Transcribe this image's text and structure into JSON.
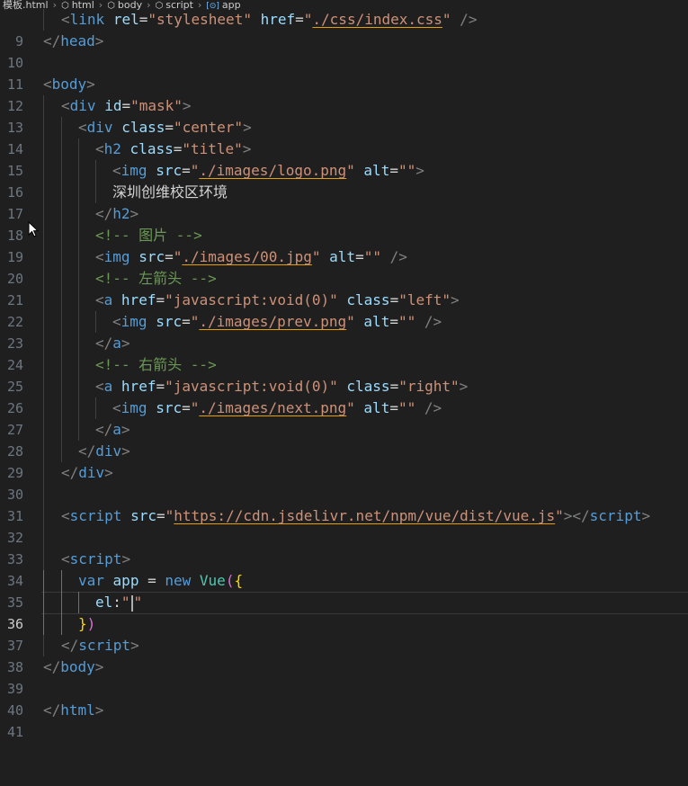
{
  "breadcrumb": {
    "items": [
      {
        "icon": "",
        "label": "模板.html"
      },
      {
        "icon": "cube-icon",
        "label": "html"
      },
      {
        "icon": "cube-icon",
        "label": "body"
      },
      {
        "icon": "cube-icon",
        "label": "script"
      },
      {
        "icon": "symbol-icon",
        "label": "app"
      }
    ]
  },
  "editor": {
    "current_line": "36",
    "colors": {
      "background": "#1f1f1f",
      "tag": "#569cd6",
      "attribute": "#9cdcfe",
      "string": "#ce9178",
      "comment": "#6a9955"
    },
    "lines": [
      {
        "num": "9",
        "parts": [
          "<",
          "link",
          " ",
          "rel",
          "=",
          "\"stylesheet\"",
          " ",
          "href",
          "=",
          "\"",
          "./css/index.css",
          "\"",
          " />"
        ]
      },
      {
        "num": "10",
        "parts": [
          "</",
          "head",
          ">"
        ]
      },
      {
        "num": "11",
        "parts": []
      },
      {
        "num": "12",
        "parts": [
          "<",
          "body",
          ">"
        ]
      },
      {
        "num": "13",
        "parts": [
          "<",
          "div",
          " ",
          "id",
          "=",
          "\"mask\"",
          ">"
        ]
      },
      {
        "num": "14",
        "parts": [
          "<",
          "div",
          " ",
          "class",
          "=",
          "\"center\"",
          ">"
        ]
      },
      {
        "num": "15",
        "parts": [
          "<",
          "h2",
          " ",
          "class",
          "=",
          "\"title\"",
          ">"
        ]
      },
      {
        "num": "16",
        "parts": [
          "<",
          "img",
          " ",
          "src",
          "=",
          "\"",
          "./images/logo.png",
          "\"",
          " ",
          "alt",
          "=",
          "\"\"",
          ">"
        ]
      },
      {
        "num": "17",
        "parts": [
          "深圳创维校区环境"
        ]
      },
      {
        "num": "18",
        "parts": [
          "</",
          "h2",
          ">"
        ]
      },
      {
        "num": "19",
        "parts": [
          "<!-- 图片 -->"
        ]
      },
      {
        "num": "20",
        "parts": [
          "<",
          "img",
          " ",
          "src",
          "=",
          "\"",
          "./images/00.jpg",
          "\"",
          " ",
          "alt",
          "=",
          "\"\"",
          " />"
        ]
      },
      {
        "num": "21",
        "parts": [
          "<!-- 左箭头 -->"
        ]
      },
      {
        "num": "22",
        "parts": [
          "<",
          "a",
          " ",
          "href",
          "=",
          "\"javascript:void(0)\"",
          " ",
          "class",
          "=",
          "\"left\"",
          ">"
        ]
      },
      {
        "num": "23",
        "parts": [
          "<",
          "img",
          " ",
          "src",
          "=",
          "\"",
          "./images/prev.png",
          "\"",
          " ",
          "alt",
          "=",
          "\"\"",
          " />"
        ]
      },
      {
        "num": "24",
        "parts": [
          "</",
          "a",
          ">"
        ]
      },
      {
        "num": "25",
        "parts": [
          "<!-- 右箭头 -->"
        ]
      },
      {
        "num": "26",
        "parts": [
          "<",
          "a",
          " ",
          "href",
          "=",
          "\"javascript:void(0)\"",
          " ",
          "class",
          "=",
          "\"right\"",
          ">"
        ]
      },
      {
        "num": "27",
        "parts": [
          "<",
          "img",
          " ",
          "src",
          "=",
          "\"",
          "./images/next.png",
          "\"",
          " ",
          "alt",
          "=",
          "\"\"",
          " />"
        ]
      },
      {
        "num": "28",
        "parts": [
          "</",
          "a",
          ">"
        ]
      },
      {
        "num": "29",
        "parts": [
          "</",
          "div",
          ">"
        ]
      },
      {
        "num": "30",
        "parts": [
          "</",
          "div",
          ">"
        ]
      },
      {
        "num": "31",
        "parts": []
      },
      {
        "num": "32",
        "parts": [
          "<",
          "script",
          " ",
          "src",
          "=",
          "\"",
          "https://cdn.jsdelivr.net/npm/vue/dist/vue.js",
          "\"",
          "></",
          "script",
          ">"
        ]
      },
      {
        "num": "33",
        "parts": []
      },
      {
        "num": "34",
        "parts": [
          "<",
          "script",
          ">"
        ]
      },
      {
        "num": "35",
        "parts": [
          "var",
          " ",
          "app",
          " = ",
          "new",
          " ",
          "Vue",
          "(",
          "{"
        ]
      },
      {
        "num": "36",
        "parts": [
          "el",
          ":",
          "\"",
          "\""
        ]
      },
      {
        "num": "37",
        "parts": [
          "}",
          ")"
        ]
      },
      {
        "num": "38",
        "parts": [
          "</",
          "script",
          ">"
        ]
      },
      {
        "num": "39",
        "parts": [
          "</",
          "body",
          ">"
        ]
      },
      {
        "num": "40",
        "parts": []
      },
      {
        "num": "41",
        "parts": [
          "</",
          "html",
          ">"
        ]
      }
    ]
  }
}
